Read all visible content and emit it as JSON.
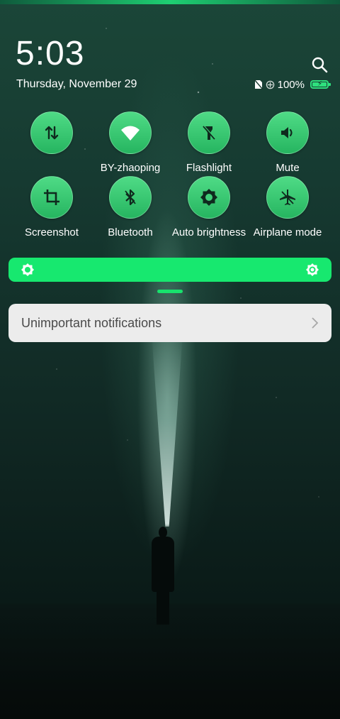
{
  "header": {
    "time": "5:03",
    "date": "Thursday, November 29"
  },
  "status_bar": {
    "battery_percent": "100%",
    "battery_color": "#2ee07d"
  },
  "quick_tiles": [
    {
      "label": "",
      "icon": "data-transfer-icon"
    },
    {
      "label": "BY-zhaoping",
      "icon": "wifi-icon"
    },
    {
      "label": "Flashlight",
      "icon": "flashlight-off-icon"
    },
    {
      "label": "Mute",
      "icon": "speaker-icon"
    },
    {
      "label": "Screenshot",
      "icon": "crop-icon"
    },
    {
      "label": "Bluetooth",
      "icon": "bluetooth-off-icon"
    },
    {
      "label": "Auto brightness",
      "icon": "brightness-icon"
    },
    {
      "label": "Airplane mode",
      "icon": "airplane-off-icon"
    }
  ],
  "brightness": {
    "level": 1.0,
    "accent": "#17e86f"
  },
  "notifications": {
    "group_label": "Unimportant notifications"
  }
}
